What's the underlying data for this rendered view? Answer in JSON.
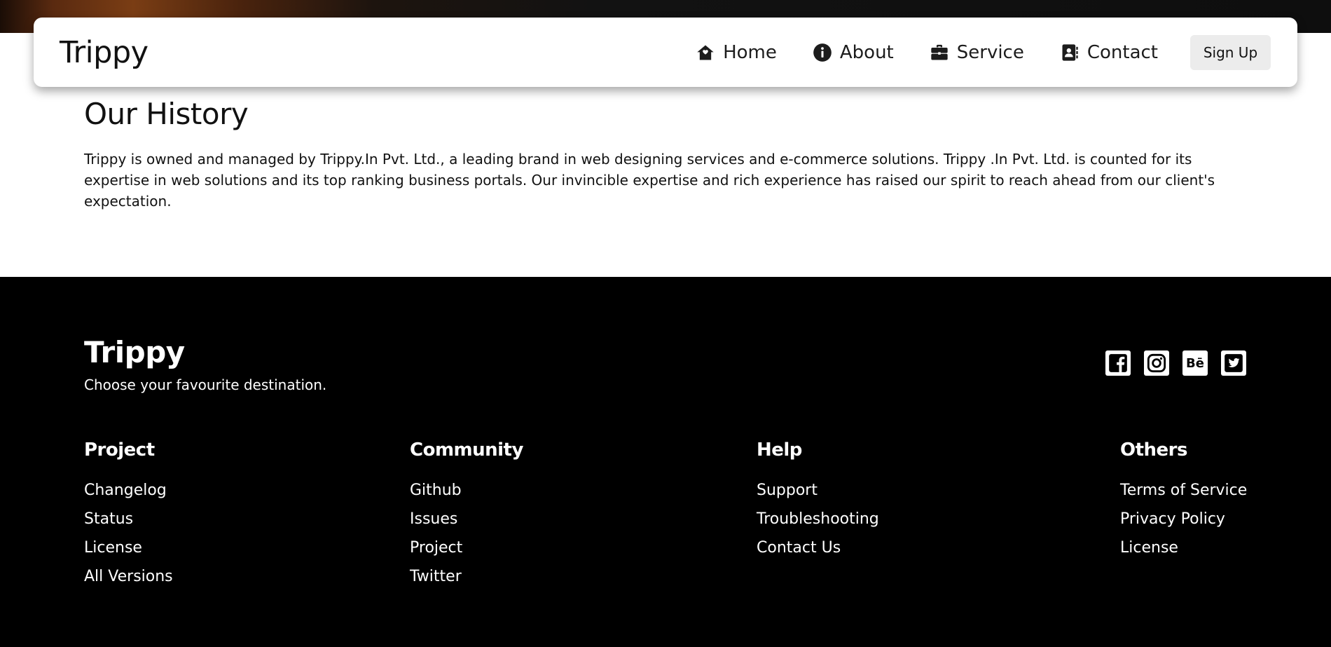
{
  "nav": {
    "brand": "Trippy",
    "items": [
      {
        "label": "Home",
        "icon": "home-icon"
      },
      {
        "label": "About",
        "icon": "info-icon"
      },
      {
        "label": "Service",
        "icon": "briefcase-icon"
      },
      {
        "label": "Contact",
        "icon": "contact-book-icon"
      }
    ],
    "signup_label": "Sign Up"
  },
  "history": {
    "title": "Our History",
    "body": "Trippy is owned and managed by Trippy.In Pvt. Ltd., a leading brand in web designing services and e-commerce solutions. Trippy .In Pvt. Ltd. is counted for its expertise in web solutions and its top ranking business portals. Our invincible expertise and rich experience has raised our spirit to reach ahead from our client's expectation."
  },
  "footer": {
    "brand": "Trippy",
    "tagline": "Choose your favourite destination.",
    "socials": [
      {
        "name": "facebook-icon"
      },
      {
        "name": "instagram-icon"
      },
      {
        "name": "behance-icon",
        "text": "Bē"
      },
      {
        "name": "twitter-icon"
      }
    ],
    "columns": [
      {
        "title": "Project",
        "links": [
          "Changelog",
          "Status",
          "License",
          "All Versions"
        ]
      },
      {
        "title": "Community",
        "links": [
          "Github",
          "Issues",
          "Project",
          "Twitter"
        ]
      },
      {
        "title": "Help",
        "links": [
          "Support",
          "Troubleshooting",
          "Contact Us"
        ]
      },
      {
        "title": "Others",
        "links": [
          "Terms of Service",
          "Privacy Policy",
          "License"
        ]
      }
    ]
  },
  "colors": {
    "footer_bg": "#000000",
    "navbar_bg": "#ffffff",
    "signup_bg": "#ececec"
  }
}
